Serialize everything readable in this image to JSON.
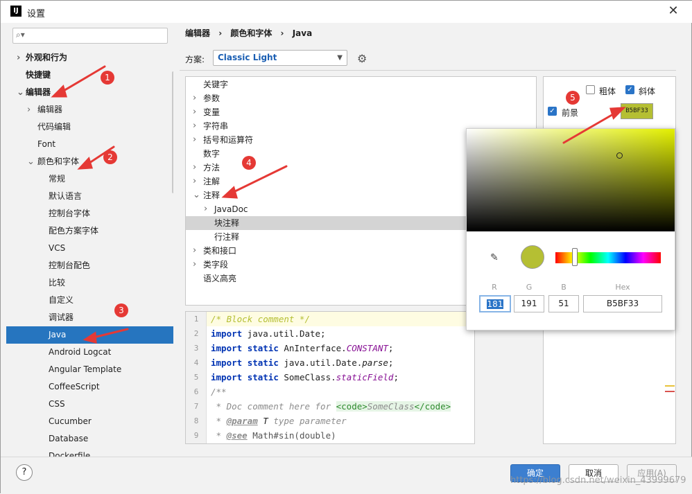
{
  "window": {
    "title": "设置",
    "app_icon_label": "IJ"
  },
  "search": {
    "placeholder": ""
  },
  "tree": [
    {
      "label": "外观和行为",
      "level": 0,
      "arrow": "right",
      "bold": true
    },
    {
      "label": "快捷键",
      "level": 0,
      "arrow": "",
      "bold": true
    },
    {
      "label": "编辑器",
      "level": 0,
      "arrow": "down",
      "bold": true
    },
    {
      "label": "编辑器",
      "level": 1,
      "arrow": "right"
    },
    {
      "label": "代码编辑",
      "level": 1,
      "arrow": ""
    },
    {
      "label": "Font",
      "level": 1,
      "arrow": ""
    },
    {
      "label": "颜色和字体",
      "level": 1,
      "arrow": "down"
    },
    {
      "label": "常规",
      "level": 2,
      "arrow": ""
    },
    {
      "label": "默认语言",
      "level": 2,
      "arrow": ""
    },
    {
      "label": "控制台字体",
      "level": 2,
      "arrow": ""
    },
    {
      "label": "配色方案字体",
      "level": 2,
      "arrow": ""
    },
    {
      "label": "VCS",
      "level": 2,
      "arrow": ""
    },
    {
      "label": "控制台配色",
      "level": 2,
      "arrow": ""
    },
    {
      "label": "比较",
      "level": 2,
      "arrow": ""
    },
    {
      "label": "自定义",
      "level": 2,
      "arrow": ""
    },
    {
      "label": "调试器",
      "level": 2,
      "arrow": ""
    },
    {
      "label": "Java",
      "level": 2,
      "arrow": "",
      "selected": true
    },
    {
      "label": "Android Logcat",
      "level": 2,
      "arrow": ""
    },
    {
      "label": "Angular Template",
      "level": 2,
      "arrow": ""
    },
    {
      "label": "CoffeeScript",
      "level": 2,
      "arrow": ""
    },
    {
      "label": "CSS",
      "level": 2,
      "arrow": ""
    },
    {
      "label": "Cucumber",
      "level": 2,
      "arrow": ""
    },
    {
      "label": "Database",
      "level": 2,
      "arrow": ""
    },
    {
      "label": "Dockerfile",
      "level": 2,
      "arrow": ""
    }
  ],
  "breadcrumb": [
    "编辑器",
    "›",
    "颜色和字体",
    "›",
    "Java"
  ],
  "scheme": {
    "label": "方案:",
    "value": "Classic Light"
  },
  "categories": [
    {
      "label": "关键字",
      "arrow": "",
      "indent": 0
    },
    {
      "label": "参数",
      "arrow": "right",
      "indent": 0
    },
    {
      "label": "变量",
      "arrow": "right",
      "indent": 0
    },
    {
      "label": "字符串",
      "arrow": "right",
      "indent": 0
    },
    {
      "label": "括号和运算符",
      "arrow": "right",
      "indent": 0
    },
    {
      "label": "数字",
      "arrow": "",
      "indent": 0
    },
    {
      "label": "方法",
      "arrow": "right",
      "indent": 0
    },
    {
      "label": "注解",
      "arrow": "right",
      "indent": 0
    },
    {
      "label": "注释",
      "arrow": "down",
      "indent": 0
    },
    {
      "label": "JavaDoc",
      "arrow": "right",
      "indent": 1
    },
    {
      "label": "块注释",
      "arrow": "",
      "indent": 1,
      "highlighted": true
    },
    {
      "label": "行注释",
      "arrow": "",
      "indent": 1
    },
    {
      "label": "类和接口",
      "arrow": "right",
      "indent": 0
    },
    {
      "label": "类字段",
      "arrow": "right",
      "indent": 0
    },
    {
      "label": "语义高亮",
      "arrow": "",
      "indent": 0
    }
  ],
  "code_lines": [
    "1",
    "2",
    "3",
    "4",
    "5",
    "6",
    "7",
    "8",
    "9"
  ],
  "code": {
    "l1": "/* Block comment */",
    "import": "import",
    "static": "static",
    "l2b": " java.util.Date;",
    "l3b": " AnInterface.",
    "l3c": "CONSTANT",
    "l4b": " java.util.Date.",
    "l4c": "parse",
    "l5b": " SomeClass.",
    "l5c": "staticField",
    "semi": ";",
    "l6": "/**",
    "l7a": " * Doc comment here for ",
    "l7b": "<code>",
    "l7c": "SomeClass",
    "l7d": "</code>",
    "l8a": " * ",
    "l8b": "@param",
    "l8c": " T",
    "l8d": " type parameter",
    "l9a": " * ",
    "l9b": "@see",
    "l9c": " Math#sin(double)"
  },
  "props": {
    "bold": "粗体",
    "italic": "斜体",
    "foreground": "前景",
    "bold_checked": false,
    "italic_checked": true,
    "foreground_checked": true,
    "foreground_hex": "B5BF33"
  },
  "picker": {
    "r_label": "R",
    "g_label": "G",
    "b_label": "B",
    "hex_label": "Hex",
    "r": "181",
    "g": "191",
    "b": "51",
    "hex": "B5BF33",
    "color": "#b5bf33"
  },
  "buttons": {
    "ok": "确定",
    "cancel": "取消",
    "apply": "应用(A)",
    "help": "?"
  },
  "annotations": [
    "1",
    "2",
    "3",
    "4",
    "5"
  ],
  "watermark": "https://blog.csdn.net/weixin_43999679",
  "colors": {
    "selection": "#2675bf",
    "comment_color": "#b5bf33",
    "primary_button": "#3c7fd0",
    "annotation": "#e53935"
  }
}
